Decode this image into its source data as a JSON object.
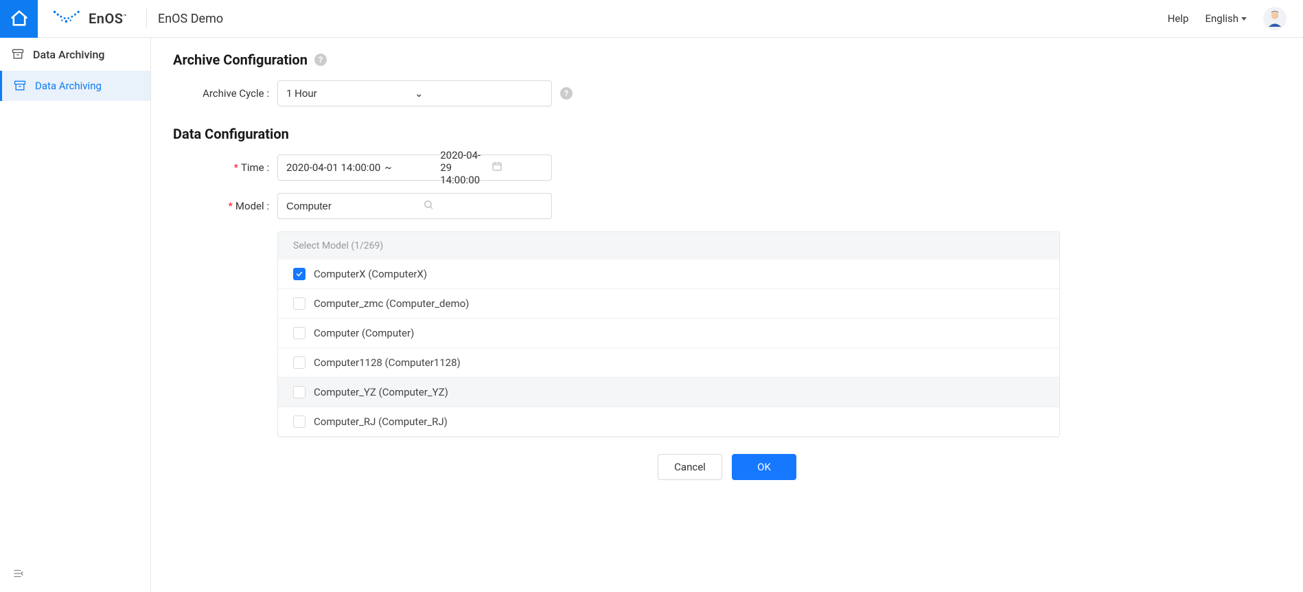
{
  "header": {
    "brand_text": "EnOS",
    "brand_tm": "™",
    "title": "EnOS Demo",
    "help_label": "Help",
    "language_label": "English"
  },
  "sidebar": {
    "section_title": "Data Archiving",
    "items": [
      {
        "label": "Data Archiving",
        "active": true
      }
    ]
  },
  "archive_config": {
    "title": "Archive Configuration",
    "cycle_label": "Archive Cycle :",
    "cycle_value": "1 Hour"
  },
  "data_config": {
    "title": "Data Configuration",
    "time_label": "Time :",
    "time_start": "2020-04-01 14:00:00",
    "time_end": "2020-04-29 14:00:00",
    "model_label": "Model :",
    "model_search_value": "Computer",
    "model_panel_header": "Select Model (1/269)",
    "models": [
      {
        "label": "ComputerX (ComputerX)",
        "checked": true,
        "hovered": false
      },
      {
        "label": "Computer_zmc (Computer_demo)",
        "checked": false,
        "hovered": false
      },
      {
        "label": "Computer (Computer)",
        "checked": false,
        "hovered": false
      },
      {
        "label": "Computer1128 (Computer1128)",
        "checked": false,
        "hovered": false
      },
      {
        "label": "Computer_YZ (Computer_YZ)",
        "checked": false,
        "hovered": true
      },
      {
        "label": "Computer_RJ (Computer_RJ)",
        "checked": false,
        "hovered": false
      }
    ]
  },
  "footer": {
    "cancel_label": "Cancel",
    "ok_label": "OK"
  }
}
